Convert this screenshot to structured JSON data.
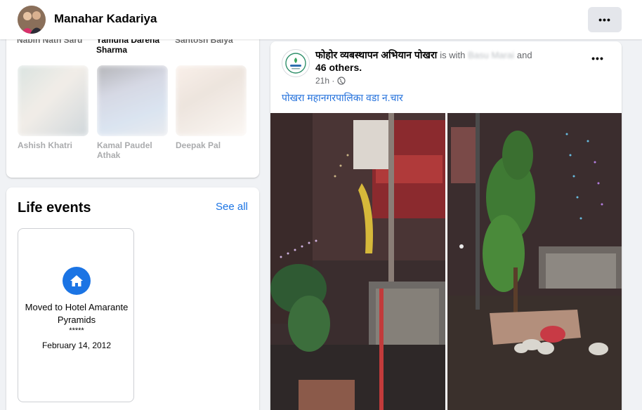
{
  "header": {
    "profile_name": "Manahar Kadariya",
    "more_label": "•••"
  },
  "friends": {
    "top_names": [
      "Nabin Nath Saru",
      "Yamuna Dareha Sharma",
      "Santosh Baiya"
    ],
    "items": [
      {
        "name": "Ashish Khatri"
      },
      {
        "name": "Kamal Paudel Athak"
      },
      {
        "name": "Deepak Pal"
      }
    ]
  },
  "life_events": {
    "title": "Life events",
    "see_all": "See all",
    "event": {
      "icon": "home-icon",
      "title": "Moved to Hotel Amarante Pyramids",
      "stars": "*****",
      "date": "February 14, 2012"
    }
  },
  "post": {
    "page_name": "फोहोर व्यबस्थापन अभियान पोखरा",
    "with_text": "is with",
    "tagged_blurred": "Basu Marai",
    "and_text": "and",
    "others": "46 others.",
    "time": "21h ·",
    "privacy_icon": "globe-icon",
    "more_label": "•••",
    "text": "पोखरा महानगरपालिका वडा न.चार",
    "photos": [
      "street-night-photo",
      "tree-planter-night-photo"
    ]
  },
  "colors": {
    "accent": "#1b74e4",
    "link": "#216fdb",
    "background": "#f0f2f5"
  }
}
